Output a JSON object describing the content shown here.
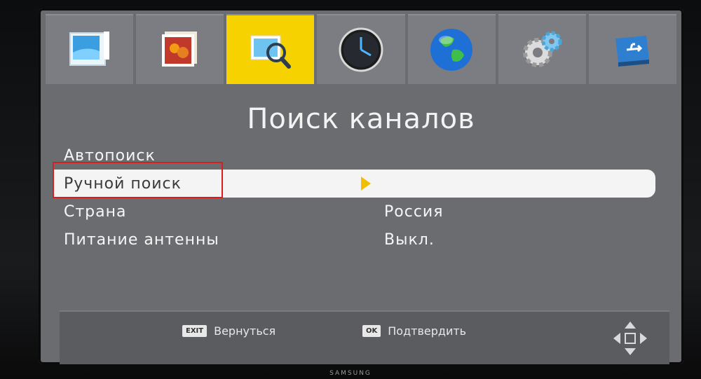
{
  "tabs": [
    {
      "icon": "picture-frame-icon"
    },
    {
      "icon": "photos-icon"
    },
    {
      "icon": "channel-search-icon",
      "active": true
    },
    {
      "icon": "clock-icon"
    },
    {
      "icon": "globe-icon"
    },
    {
      "icon": "gears-icon"
    },
    {
      "icon": "usb-icon"
    }
  ],
  "page_title": "Поиск каналов",
  "menu": [
    {
      "label": "Автопоиск",
      "value": ""
    },
    {
      "label": "Ручной поиск",
      "value": "",
      "selected": true
    },
    {
      "label": "Страна",
      "value": "Россия"
    },
    {
      "label": "Питание антенны",
      "value": "Выкл."
    }
  ],
  "footer": {
    "back_key": "EXIT",
    "back_label": "Вернуться",
    "ok_key": "OK",
    "ok_label": "Подтвердить"
  },
  "brand": "SAMSUNG",
  "colors": {
    "accent": "#f6d200",
    "highlight": "#d81e1e",
    "panel": "#6a6c70"
  }
}
